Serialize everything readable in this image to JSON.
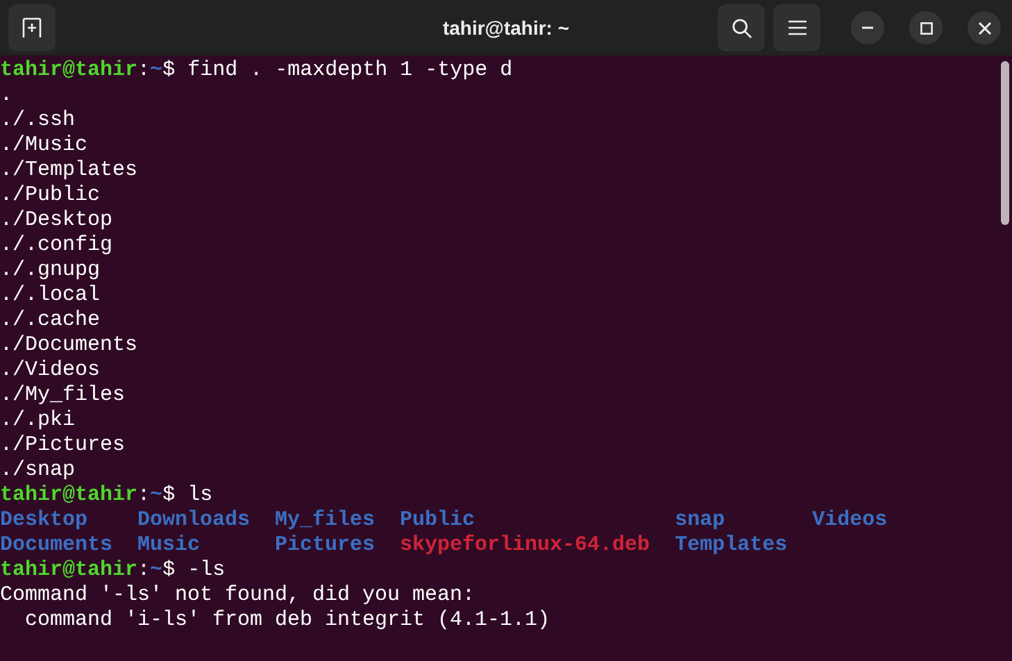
{
  "window": {
    "title": "tahir@tahir: ~"
  },
  "lines": [
    {
      "kind": "prompt",
      "user": "tahir@tahir",
      "sep": ":",
      "path": "~",
      "symbol": "$",
      "command": "find . -maxdepth 1 -type d"
    },
    {
      "kind": "output",
      "text": "."
    },
    {
      "kind": "output",
      "text": "./.ssh"
    },
    {
      "kind": "output",
      "text": "./Music"
    },
    {
      "kind": "output",
      "text": "./Templates"
    },
    {
      "kind": "output",
      "text": "./Public"
    },
    {
      "kind": "output",
      "text": "./Desktop"
    },
    {
      "kind": "output",
      "text": "./.config"
    },
    {
      "kind": "output",
      "text": "./.gnupg"
    },
    {
      "kind": "output",
      "text": "./.local"
    },
    {
      "kind": "output",
      "text": "./.cache"
    },
    {
      "kind": "output",
      "text": "./Documents"
    },
    {
      "kind": "output",
      "text": "./Videos"
    },
    {
      "kind": "output",
      "text": "./My_files"
    },
    {
      "kind": "output",
      "text": "./.pki"
    },
    {
      "kind": "output",
      "text": "./Pictures"
    },
    {
      "kind": "output",
      "text": "./snap"
    },
    {
      "kind": "prompt",
      "user": "tahir@tahir",
      "sep": ":",
      "path": "~",
      "symbol": "$",
      "command": "ls"
    },
    {
      "kind": "listing",
      "columns": [
        [
          {
            "name": "Desktop",
            "kind": "dir"
          },
          {
            "name": "Documents",
            "kind": "dir"
          }
        ],
        [
          {
            "name": "Downloads",
            "kind": "dir"
          },
          {
            "name": "Music",
            "kind": "dir"
          }
        ],
        [
          {
            "name": "My_files",
            "kind": "dir"
          },
          {
            "name": "Pictures",
            "kind": "dir"
          }
        ],
        [
          {
            "name": "Public",
            "kind": "dir"
          },
          {
            "name": "skypeforlinux-64.deb",
            "kind": "archive"
          }
        ],
        [
          {
            "name": "snap",
            "kind": "dir"
          },
          {
            "name": "Templates",
            "kind": "dir"
          }
        ],
        [
          {
            "name": "Videos",
            "kind": "dir"
          }
        ]
      ]
    },
    {
      "kind": "prompt",
      "user": "tahir@tahir",
      "sep": ":",
      "path": "~",
      "symbol": "$",
      "command": "-ls"
    },
    {
      "kind": "output",
      "text": "Command '-ls' not found, did you mean:"
    },
    {
      "kind": "output",
      "text": "  command 'i-ls' from deb integrit (4.1-1.1)"
    }
  ]
}
